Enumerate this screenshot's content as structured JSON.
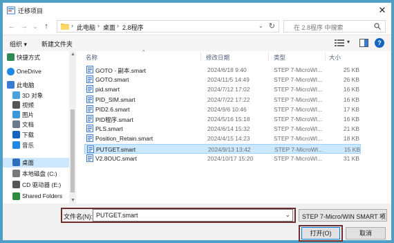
{
  "window": {
    "title": "迁移项目",
    "close_glyph": "✕"
  },
  "nav": {
    "back": "←",
    "forward": "→",
    "recent": "⌄",
    "up": "↑",
    "breadcrumb": [
      "此电脑",
      "桌面",
      "2.8程序"
    ],
    "separator": "›",
    "search_placeholder": "在 2.8程序 中搜索"
  },
  "toolbar": {
    "organize": "组织 ▾",
    "new_folder": "新建文件夹",
    "help": "?"
  },
  "sidebar": {
    "items": [
      {
        "label": "快捷方式",
        "icon": "shortcut-icon"
      },
      {
        "label": "OneDrive",
        "icon": "cloud-icon"
      },
      {
        "label": "此电脑",
        "icon": "computer-icon"
      },
      {
        "label": "3D 对象",
        "icon": "cube-icon"
      },
      {
        "label": "视频",
        "icon": "video-icon"
      },
      {
        "label": "图片",
        "icon": "picture-icon"
      },
      {
        "label": "文档",
        "icon": "document-icon"
      },
      {
        "label": "下载",
        "icon": "download-icon"
      },
      {
        "label": "音乐",
        "icon": "music-icon"
      },
      {
        "label": "桌面",
        "icon": "desktop-icon",
        "selected": true
      },
      {
        "label": "本地磁盘 (C:)",
        "icon": "drive-icon"
      },
      {
        "label": "CD 驱动器 (E:)",
        "icon": "cd-drive-icon"
      },
      {
        "label": "Shared Folders",
        "icon": "network-icon"
      }
    ]
  },
  "columns": {
    "name": "名称",
    "date": "修改日期",
    "type": "类型",
    "size": "大小"
  },
  "files": [
    {
      "name": "GOTO - 副本.smart",
      "date": "2024/6/18 9:40",
      "type": "STEP 7-MicroWI...",
      "size": "25 KB"
    },
    {
      "name": "GOTO.smart",
      "date": "2024/11/5 14:49",
      "type": "STEP 7-MicroWI...",
      "size": "26 KB"
    },
    {
      "name": "pid.smart",
      "date": "2024/7/12 17:02",
      "type": "STEP 7-MicroWI...",
      "size": "16 KB"
    },
    {
      "name": "PID_SIM.smart",
      "date": "2024/7/22 17:22",
      "type": "STEP 7-MicroWI...",
      "size": "16 KB"
    },
    {
      "name": "PID2.6.smart",
      "date": "2024/9/6 10:46",
      "type": "STEP 7-MicroWI...",
      "size": "17 KB"
    },
    {
      "name": "PID程序.smart",
      "date": "2024/5/16 15:18",
      "type": "STEP 7-MicroWI...",
      "size": "16 KB"
    },
    {
      "name": "PLS.smart",
      "date": "2024/6/14 15:32",
      "type": "STEP 7-MicroWI...",
      "size": "21 KB"
    },
    {
      "name": "Position_Retain.smart",
      "date": "2024/4/15 14:23",
      "type": "STEP 7-MicroWI...",
      "size": "18 KB"
    },
    {
      "name": "PUTGET.smart",
      "date": "2024/9/13 13:42",
      "type": "STEP 7-MicroWI...",
      "size": "15 KB",
      "selected": true
    },
    {
      "name": "V2.8OUC.smart",
      "date": "2024/10/17 15:20",
      "type": "STEP 7-MicroWI...",
      "size": "31 KB"
    }
  ],
  "bottom": {
    "filename_label": "文件名(N):",
    "filename_value": "PUTGET.smart",
    "filetype_value": "STEP 7-Micro/WIN SMART 项",
    "open_label": "打开(O)",
    "cancel_label": "取消"
  },
  "colors": {
    "accent": "#0078d7",
    "selection": "#cce8ff",
    "highlight_box": "#6b2e2e",
    "frame": "#4f9ec6"
  }
}
